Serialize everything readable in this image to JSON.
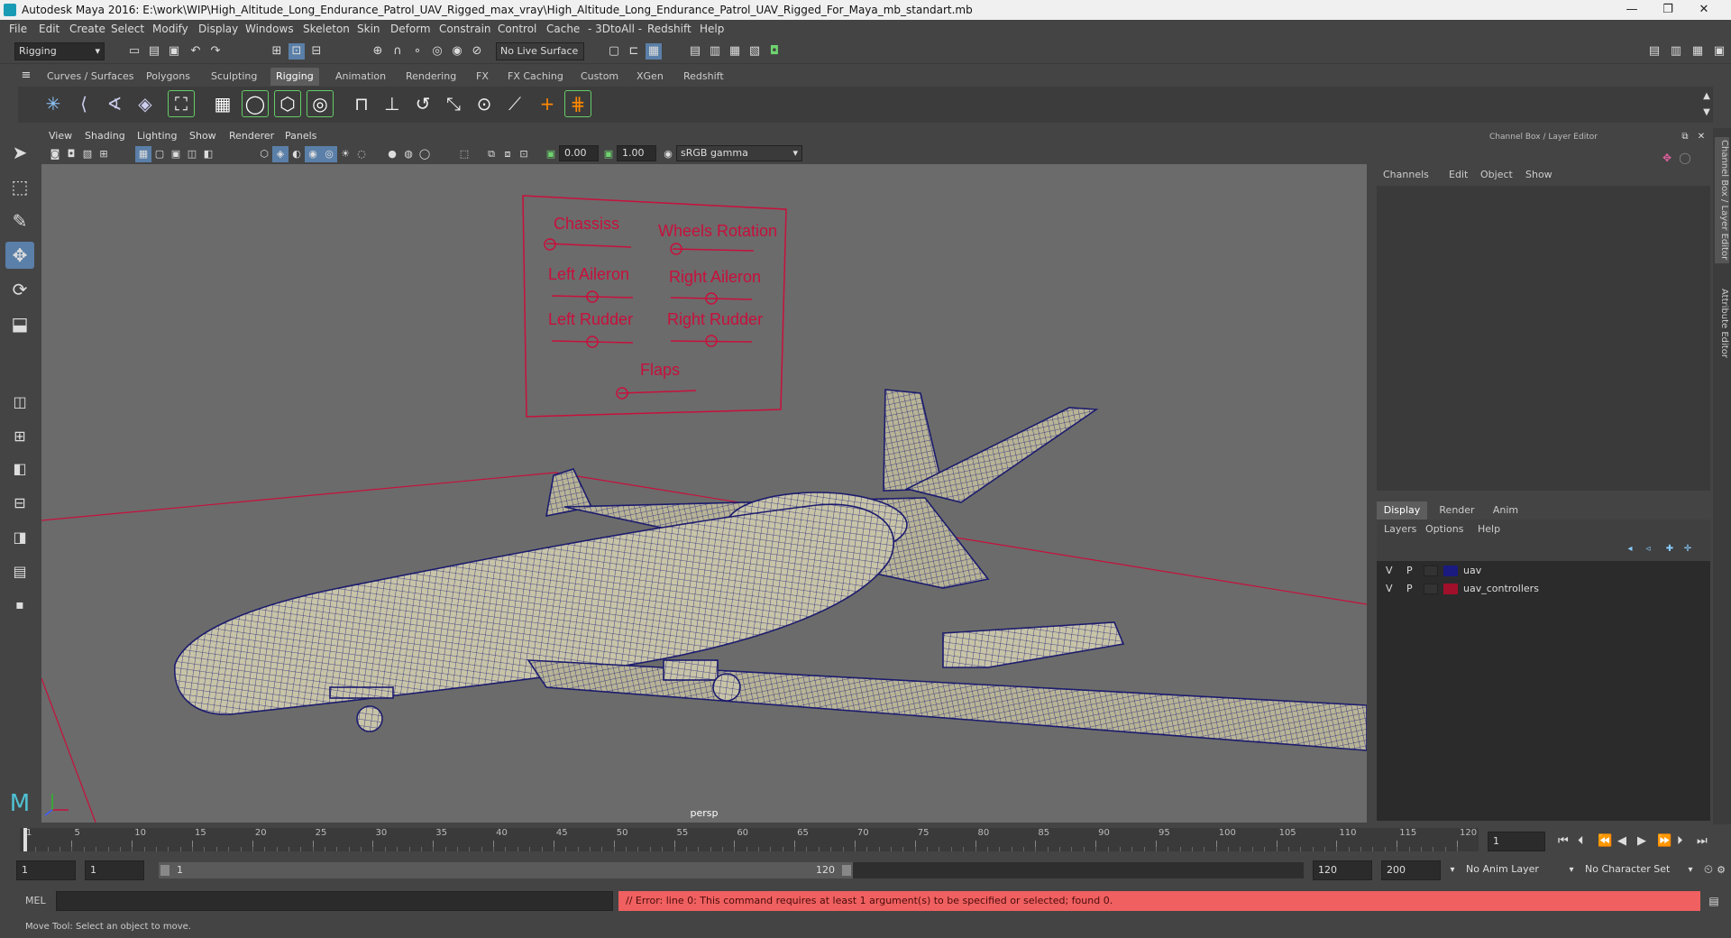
{
  "titlebar": {
    "title": "Autodesk Maya 2016: E:\\work\\WIP\\High_Altitude_Long_Endurance_Patrol_UAV_Rigged_max_vray\\High_Altitude_Long_Endurance_Patrol_UAV_Rigged_For_Maya_mb_standart.mb",
    "minimize": "—",
    "maximize": "❐",
    "close": "✕"
  },
  "menubar": [
    "File",
    "Edit",
    "Create",
    "Select",
    "Modify",
    "Display",
    "Windows",
    "Skeleton",
    "Skin",
    "Deform",
    "Constrain",
    "Control",
    "Cache",
    "- 3DtoAll -",
    "Redshift",
    "Help"
  ],
  "toolbar": {
    "mode_select": "Rigging",
    "live_surface": "No Live Surface"
  },
  "shelf_tabs": [
    "Curves / Surfaces",
    "Polygons",
    "Sculpting",
    "Rigging",
    "Animation",
    "Rendering",
    "FX",
    "FX Caching",
    "Custom",
    "XGen",
    "Redshift"
  ],
  "shelf_active": "Rigging",
  "viewport": {
    "menu": [
      "View",
      "Shading",
      "Lighting",
      "Show",
      "Renderer",
      "Panels"
    ],
    "field_a": "0.00",
    "field_b": "1.00",
    "colorspace": "sRGB gamma",
    "camera_label": "persp"
  },
  "controls_board": {
    "labels": [
      "Chassiss",
      "Wheels Rotation",
      "Left Aileron",
      "Right Aileron",
      "Left Rudder",
      "Right Rudder",
      "Flaps"
    ],
    "color": "#c8103c"
  },
  "channel_box": {
    "title": "Channel Box / Layer Editor",
    "menu": [
      "Channels",
      "Edit",
      "Object",
      "Show"
    ]
  },
  "layer_editor": {
    "tabs": [
      "Display",
      "Render",
      "Anim"
    ],
    "active_tab": "Display",
    "menu": [
      "Layers",
      "Options",
      "Help"
    ],
    "layers": [
      {
        "v": "V",
        "p": "P",
        "name": "uav",
        "color": "#1a1a80"
      },
      {
        "v": "V",
        "p": "P",
        "name": "uav_controllers",
        "color": "#a0102a"
      }
    ]
  },
  "side_tabs": [
    "Channel Box / Layer Editor",
    "Attribute Editor"
  ],
  "timeline": {
    "ticks": [
      "1",
      "5",
      "10",
      "15",
      "20",
      "25",
      "30",
      "35",
      "40",
      "45",
      "50",
      "55",
      "60",
      "65",
      "70",
      "75",
      "80",
      "85",
      "90",
      "95",
      "100",
      "105",
      "110",
      "115",
      "120"
    ],
    "current_frame": "1"
  },
  "range": {
    "start": "1",
    "playback_start": "1",
    "slider_left": "1",
    "slider_right": "120",
    "playback_end": "120",
    "end": "200",
    "anim_layer": "No Anim Layer",
    "character_set": "No Character Set"
  },
  "command": {
    "lang": "MEL",
    "error": "// Error: line 0: This command requires at least 1 argument(s) to be specified or selected;  found 0."
  },
  "help_line": "Move Tool: Select an object to move."
}
